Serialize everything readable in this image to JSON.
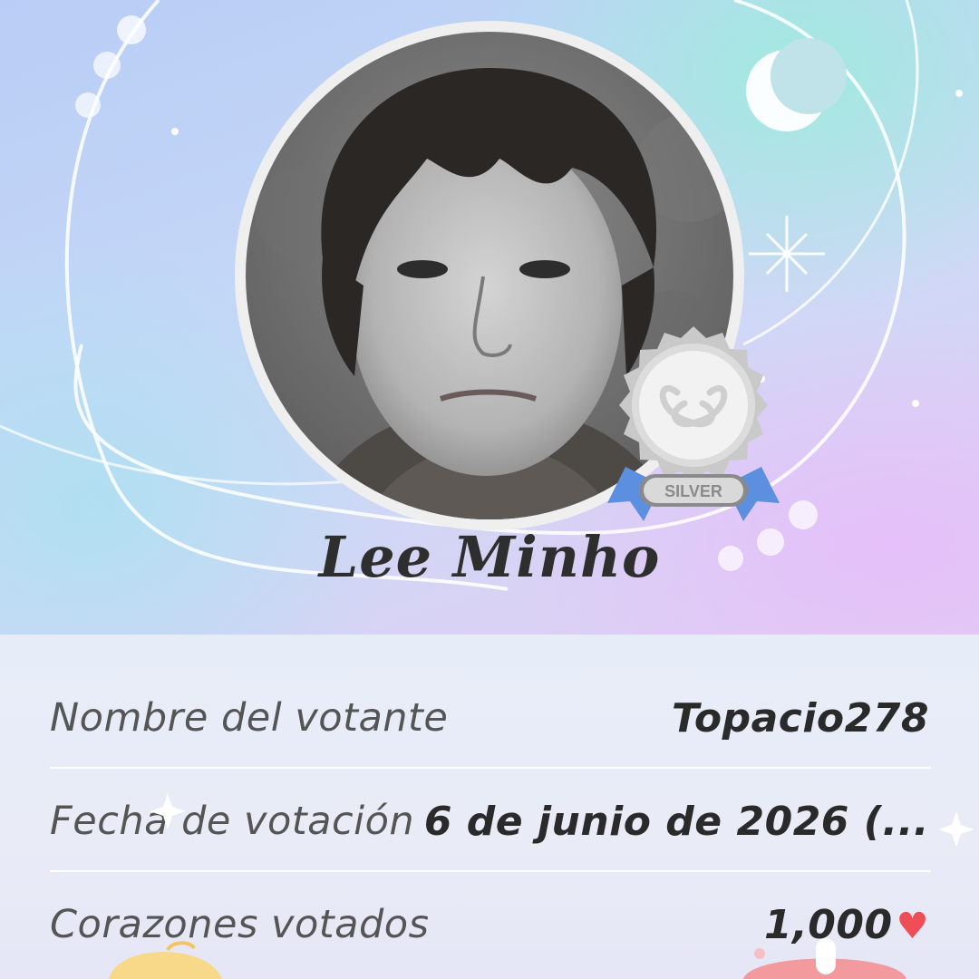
{
  "artist": {
    "name": "Lee Minho",
    "photo_alt": "Lee Minho"
  },
  "badge": {
    "label": "SILVER",
    "icon": "heart-ribbon-medal-icon"
  },
  "info": {
    "rows": [
      {
        "label": "Nombre del votante",
        "value": "Topacio278"
      },
      {
        "label": "Fecha de votación",
        "value": "6 de junio de 2026 (..."
      },
      {
        "label": "Corazones votados",
        "value": "1,000"
      }
    ],
    "heart_icon": "heart-icon"
  },
  "colors": {
    "heart": "#ef4e57",
    "medal_ribbon": "#5d8fe0",
    "medal_silver": "#c9c9c9"
  }
}
